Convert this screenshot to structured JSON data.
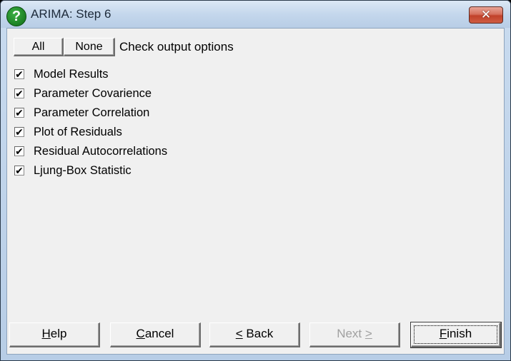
{
  "window": {
    "title": "ARIMA: Step 6",
    "icon": "help-question-icon",
    "close_symbol": "✕"
  },
  "toolbar": {
    "all_label": "All",
    "none_label": "None",
    "header": "Check output options"
  },
  "options": [
    {
      "label": "Model Results",
      "checked": true
    },
    {
      "label": "Parameter Covarience",
      "checked": true
    },
    {
      "label": "Parameter Correlation",
      "checked": true
    },
    {
      "label": "Plot of Residuals",
      "checked": true
    },
    {
      "label": "Residual Autocorrelations",
      "checked": true
    },
    {
      "label": "Ljung-Box Statistic",
      "checked": true
    }
  ],
  "checkmark": "✔",
  "footer": {
    "help": {
      "mnemonic": "H",
      "rest": "elp"
    },
    "cancel": {
      "mnemonic": "C",
      "rest": "ancel"
    },
    "back": {
      "mnemonic": "<",
      "rest": " Back"
    },
    "next": {
      "text": "Next ",
      "mnemonic": ">",
      "disabled": true
    },
    "finish": {
      "mnemonic": "F",
      "rest": "inish",
      "default": true
    }
  }
}
